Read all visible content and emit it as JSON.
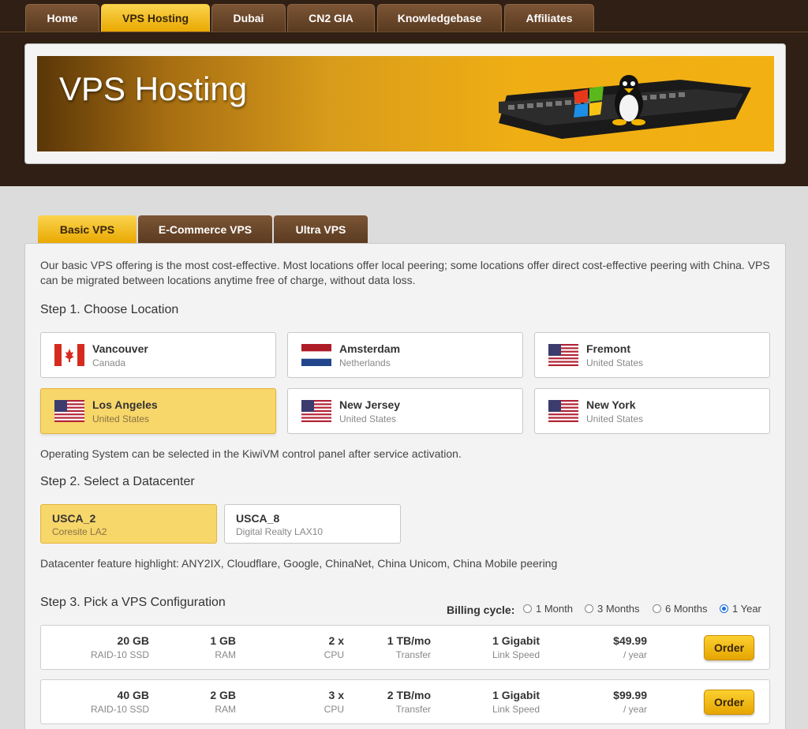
{
  "nav": {
    "tabs": [
      {
        "label": "Home",
        "active": false
      },
      {
        "label": "VPS Hosting",
        "active": true
      },
      {
        "label": "Dubai",
        "active": false
      },
      {
        "label": "CN2 GIA",
        "active": false
      },
      {
        "label": "Knowledgebase",
        "active": false
      },
      {
        "label": "Affiliates",
        "active": false
      }
    ]
  },
  "banner": {
    "title": "VPS Hosting",
    "image": "network-switch-with-windows-and-linux-logos"
  },
  "plan_tabs": [
    {
      "label": "Basic VPS",
      "active": true
    },
    {
      "label": "E-Commerce VPS",
      "active": false
    },
    {
      "label": "Ultra VPS",
      "active": false
    }
  ],
  "intro": "Our basic VPS offering is the most cost-effective. Most locations offer local peering; some locations offer direct cost-effective peering with China. VPS can be migrated between locations anytime free of charge, without data loss.",
  "step1": {
    "title": "Step 1. Choose Location",
    "locations": [
      {
        "name": "Vancouver",
        "country": "Canada",
        "flag": "canada-flag",
        "selected": false
      },
      {
        "name": "Amsterdam",
        "country": "Netherlands",
        "flag": "netherlands-flag",
        "selected": false
      },
      {
        "name": "Fremont",
        "country": "United States",
        "flag": "us-flag",
        "selected": false
      },
      {
        "name": "Los Angeles",
        "country": "United States",
        "flag": "us-flag",
        "selected": true
      },
      {
        "name": "New Jersey",
        "country": "United States",
        "flag": "us-flag",
        "selected": false
      },
      {
        "name": "New York",
        "country": "United States",
        "flag": "us-flag",
        "selected": false
      }
    ],
    "note": "Operating System can be selected in the KiwiVM control panel after service activation."
  },
  "step2": {
    "title": "Step 2. Select a Datacenter",
    "datacenters": [
      {
        "name": "USCA_2",
        "sub": "Coresite LA2",
        "selected": true
      },
      {
        "name": "USCA_8",
        "sub": "Digital Realty LAX10",
        "selected": false
      }
    ],
    "note": "Datacenter feature highlight: ANY2IX, Cloudflare, Google, ChinaNet, China Unicom, China Mobile peering"
  },
  "step3": {
    "title": "Step 3. Pick a VPS Configuration",
    "billing_label": "Billing cycle:",
    "billing_options": [
      {
        "label": "1 Month",
        "selected": false
      },
      {
        "label": "3 Months",
        "selected": false
      },
      {
        "label": "6 Months",
        "selected": false
      },
      {
        "label": "1 Year",
        "selected": true
      }
    ],
    "plans": [
      {
        "disk": "20 GB",
        "disk_label": "RAID-10 SSD",
        "ram": "1 GB",
        "ram_label": "RAM",
        "cpu": "2 x",
        "cpu_label": "CPU",
        "transfer": "1 TB/mo",
        "transfer_label": "Transfer",
        "link": "1 Gigabit",
        "link_label": "Link Speed",
        "price": "$49.99",
        "period": "/ year",
        "order_label": "Order"
      },
      {
        "disk": "40 GB",
        "disk_label": "RAID-10 SSD",
        "ram": "2 GB",
        "ram_label": "RAM",
        "cpu": "3 x",
        "cpu_label": "CPU",
        "transfer": "2 TB/mo",
        "transfer_label": "Transfer",
        "link": "1 Gigabit",
        "link_label": "Link Speed",
        "price": "$99.99",
        "period": "/ year",
        "order_label": "Order"
      }
    ]
  }
}
